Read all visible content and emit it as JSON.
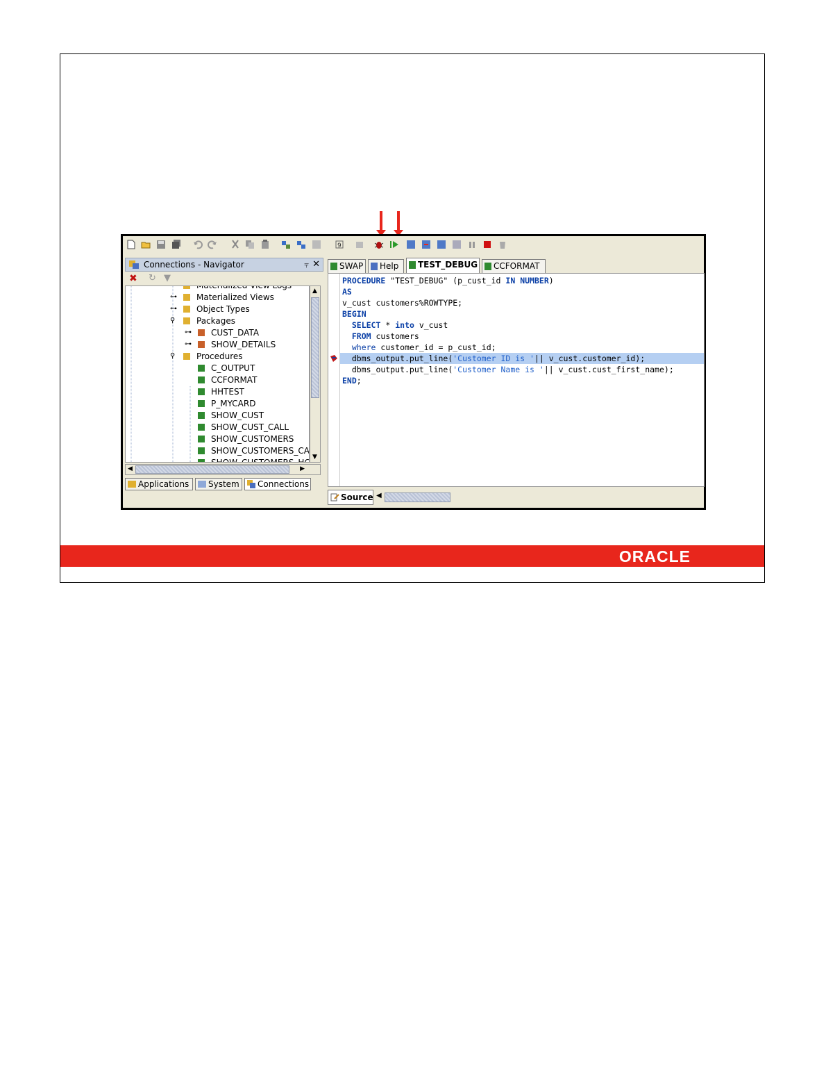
{
  "slide": {
    "brand": "ORACLE",
    "colors": {
      "band": "#e8261c",
      "selection": "#b5cff2",
      "keyword": "#0a3fa6"
    }
  },
  "toolbar": {
    "buttons": [
      "new-icon",
      "open-icon",
      "save-icon",
      "save-all-icon",
      "undo-icon",
      "redo-icon",
      "cut-icon",
      "copy-icon",
      "paste-icon",
      "compile-icon",
      "compile-debug-icon",
      "explain-icon",
      "run-icon",
      "breakpoint-icon",
      "debug-icon",
      "resume-icon",
      "step-over-icon",
      "step-into-icon",
      "step-out-icon",
      "step-to-end-icon",
      "pause-icon",
      "terminate-icon",
      "garbage-collect-icon"
    ]
  },
  "navigator": {
    "title": "Connections - Navigator",
    "pin_glyph": "⫧",
    "close_glyph": "✕",
    "tree": [
      {
        "label": "Materialized View Logs",
        "level": 0,
        "expander": "plus"
      },
      {
        "label": "Materialized Views",
        "level": 0,
        "expander": "plus"
      },
      {
        "label": "Object Types",
        "level": 0,
        "expander": "plus"
      },
      {
        "label": "Packages",
        "level": 0,
        "expander": "minus"
      },
      {
        "label": "CUST_DATA",
        "level": 1,
        "expander": "plus"
      },
      {
        "label": "SHOW_DETAILS",
        "level": 1,
        "expander": "plus"
      },
      {
        "label": "Procedures",
        "level": 0,
        "expander": "minus"
      },
      {
        "label": "C_OUTPUT",
        "level": 1,
        "expander": ""
      },
      {
        "label": "CCFORMAT",
        "level": 1,
        "expander": ""
      },
      {
        "label": "HHTEST",
        "level": 1,
        "expander": ""
      },
      {
        "label": "P_MYCARD",
        "level": 1,
        "expander": ""
      },
      {
        "label": "SHOW_CUST",
        "level": 1,
        "expander": ""
      },
      {
        "label": "SHOW_CUST_CALL",
        "level": 1,
        "expander": ""
      },
      {
        "label": "SHOW_CUSTOMERS",
        "level": 1,
        "expander": ""
      },
      {
        "label": "SHOW_CUSTOMERS_CA",
        "level": 1,
        "expander": ""
      },
      {
        "label": "SHOW_CUSTOMERS_HC",
        "level": 1,
        "expander": ""
      }
    ],
    "tabs": [
      "Applications",
      "System",
      "Connections"
    ]
  },
  "editor": {
    "tabs": [
      "SWAP",
      "Help",
      "TEST_DEBUG",
      "CCFORMAT"
    ],
    "active_tab": "TEST_DEBUG",
    "bottom_tab": "Source",
    "code": [
      [
        {
          "t": "PROCEDURE",
          "c": "kw"
        },
        {
          "t": " \"TEST_DEBUG\" (p_cust_id ",
          "c": ""
        },
        {
          "t": "IN",
          "c": "kw"
        },
        {
          "t": " ",
          "c": ""
        },
        {
          "t": "NUMBER",
          "c": "kw"
        },
        {
          "t": ")",
          "c": ""
        }
      ],
      [
        {
          "t": "AS",
          "c": "kw"
        }
      ],
      [
        {
          "t": "v_cust customers%ROWTYPE;",
          "c": ""
        }
      ],
      [
        {
          "t": "BEGIN",
          "c": "kw"
        }
      ],
      [
        {
          "t": "  ",
          "c": ""
        },
        {
          "t": "SELECT",
          "c": "kw"
        },
        {
          "t": " * ",
          "c": ""
        },
        {
          "t": "into",
          "c": "kw"
        },
        {
          "t": " v_cust",
          "c": ""
        }
      ],
      [
        {
          "t": "  ",
          "c": ""
        },
        {
          "t": "FROM",
          "c": "kw"
        },
        {
          "t": " customers",
          "c": ""
        }
      ],
      [
        {
          "t": "  ",
          "c": ""
        },
        {
          "t": "where",
          "c": "kw2"
        },
        {
          "t": " customer_id = p_cust_id;",
          "c": ""
        }
      ],
      [
        {
          "t": "  dbms_output.put_line(",
          "c": ""
        },
        {
          "t": "'Customer ID is '",
          "c": "str"
        },
        {
          "t": "|| v_cust.customer_id);",
          "c": ""
        }
      ],
      [
        {
          "t": "  dbms_output.put_line(",
          "c": ""
        },
        {
          "t": "'Customer Name is '",
          "c": "str"
        },
        {
          "t": "|| v_cust.cust_first_name);",
          "c": ""
        }
      ],
      [
        {
          "t": "END",
          "c": "kw"
        },
        {
          "t": ";",
          "c": ""
        }
      ]
    ],
    "highlight_line_index": 7
  }
}
